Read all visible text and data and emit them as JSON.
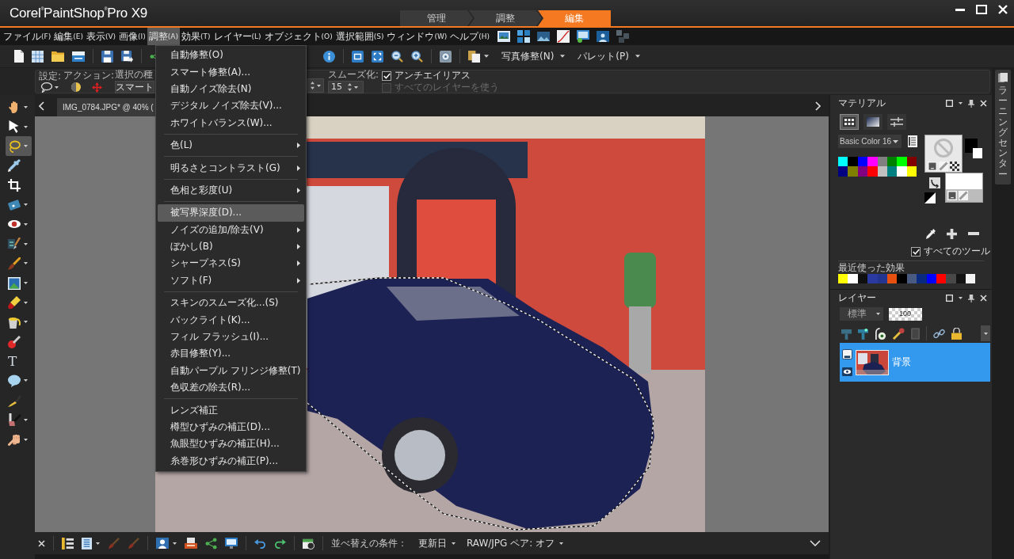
{
  "title_bar": {
    "app_title": "Corel$^{®}$PaintShop$^{®}$Pro X9",
    "workspace_tabs": [
      {
        "label": "管理",
        "selected": false
      },
      {
        "label": "調整",
        "selected": false
      },
      {
        "label": "編集",
        "selected": true
      }
    ]
  },
  "menu_bar": {
    "items": [
      {
        "label": "ファイル",
        "key": "(F)",
        "selected": false
      },
      {
        "label": "編集",
        "key": "(E)",
        "selected": false
      },
      {
        "label": "表示",
        "key": "(V)",
        "selected": false
      },
      {
        "label": "画像",
        "key": "(I)",
        "selected": false
      },
      {
        "label": "調整",
        "key": "(A)",
        "selected": true
      },
      {
        "label": "効果",
        "key": "(T)",
        "selected": false
      },
      {
        "label": "レイヤー",
        "key": "(L)",
        "selected": false
      },
      {
        "label": "オブジェクト",
        "key": "(O)",
        "selected": false
      },
      {
        "label": "選択範囲",
        "key": "(S)",
        "selected": false
      },
      {
        "label": "ウィンドウ",
        "key": "(W)",
        "selected": false
      },
      {
        "label": "ヘルプ",
        "key": "(H)",
        "selected": false
      }
    ]
  },
  "toolbar": {
    "photo_fix": "写真修整(N)",
    "palettes": "パレット(P)"
  },
  "tool_options": {
    "presets_label": "設定:",
    "actions_label": "アクション:",
    "selection_type_label": "選択の種",
    "selection_type_value": "スマート",
    "smoothing_label": "スムーズ化:",
    "smoothing_value": "15",
    "antialias": {
      "label": "アンチエイリアス",
      "checked": true,
      "disabled": false
    },
    "all_layers": {
      "label": "すべてのレイヤーを使う",
      "checked": false,
      "disabled": true
    }
  },
  "toolbox": [
    {
      "selected": false,
      "dropdown": true
    },
    {
      "selected": false,
      "dropdown": true
    },
    {
      "selected": true,
      "dropdown": true
    },
    {
      "selected": false,
      "dropdown": false
    },
    {
      "selected": false,
      "dropdown": false
    },
    {
      "selected": false,
      "dropdown": true
    },
    {
      "selected": false,
      "dropdown": true
    },
    {
      "selected": false,
      "dropdown": true
    },
    {
      "selected": false,
      "dropdown": true
    },
    {
      "selected": false,
      "dropdown": true
    },
    {
      "selected": false,
      "dropdown": true
    },
    {
      "selected": false,
      "dropdown": true
    },
    {
      "selected": false,
      "dropdown": false
    },
    {
      "selected": false,
      "dropdown": false,
      "glyph": "T"
    },
    {
      "selected": false,
      "dropdown": true
    },
    {
      "selected": false,
      "dropdown": false
    },
    {
      "selected": false,
      "dropdown": true
    },
    {
      "selected": false,
      "dropdown": true
    }
  ],
  "document_tab": {
    "label": "IMG_0784.JPG* @ 40% ("
  },
  "adjust_menu": {
    "items": [
      {
        "kind": "item",
        "label": "自動修整(O)",
        "selected": false,
        "submenu": false
      },
      {
        "kind": "item",
        "label": "スマート修整(A)...",
        "selected": false,
        "submenu": false
      },
      {
        "kind": "item",
        "label": "自動ノイズ除去(N)",
        "selected": false,
        "submenu": false
      },
      {
        "kind": "item",
        "label": "デジタル ノイズ除去(V)...",
        "selected": false,
        "submenu": false
      },
      {
        "kind": "item",
        "label": "ホワイトバランス(W)...",
        "selected": false,
        "submenu": false
      },
      {
        "kind": "separator"
      },
      {
        "kind": "item",
        "label": "色(L)",
        "selected": false,
        "submenu": true
      },
      {
        "kind": "separator"
      },
      {
        "kind": "item",
        "label": "明るさとコントラスト(G)",
        "selected": false,
        "submenu": true
      },
      {
        "kind": "separator"
      },
      {
        "kind": "item",
        "label": "色相と彩度(U)",
        "selected": false,
        "submenu": true
      },
      {
        "kind": "separator"
      },
      {
        "kind": "item",
        "label": "被写界深度(D)...",
        "selected": true,
        "submenu": false
      },
      {
        "kind": "item",
        "label": "ノイズの追加/除去(V)",
        "selected": false,
        "submenu": true
      },
      {
        "kind": "item",
        "label": "ぼかし(B)",
        "selected": false,
        "submenu": true
      },
      {
        "kind": "item",
        "label": "シャープネス(S)",
        "selected": false,
        "submenu": true
      },
      {
        "kind": "item",
        "label": "ソフト(F)",
        "selected": false,
        "submenu": true
      },
      {
        "kind": "separator"
      },
      {
        "kind": "item",
        "label": "スキンのスムーズ化...(S)",
        "selected": false,
        "submenu": false
      },
      {
        "kind": "item",
        "label": "バックライト(K)...",
        "selected": false,
        "submenu": false
      },
      {
        "kind": "item",
        "label": "フィル フラッシュ(I)...",
        "selected": false,
        "submenu": false
      },
      {
        "kind": "item",
        "label": "赤目修整(Y)...",
        "selected": false,
        "submenu": false
      },
      {
        "kind": "item",
        "label": "自動パープル フリンジ修整(T)",
        "selected": false,
        "submenu": false
      },
      {
        "kind": "item",
        "label": "色収差の除去(R)...",
        "selected": false,
        "submenu": false
      },
      {
        "kind": "separator"
      },
      {
        "kind": "item",
        "label": "レンズ補正",
        "selected": false,
        "submenu": false
      },
      {
        "kind": "item",
        "label": "樽型ひずみの補正(D)...",
        "selected": false,
        "submenu": false
      },
      {
        "kind": "item",
        "label": "魚眼型ひずみの補正(H)...",
        "selected": false,
        "submenu": false
      },
      {
        "kind": "item",
        "label": "糸巻形ひずみの補正(P)...",
        "selected": false,
        "submenu": false
      }
    ]
  },
  "materials_panel": {
    "title": "マテリアル",
    "view_tabs": [
      {
        "selected": true
      },
      {
        "selected": false
      },
      {
        "selected": false
      }
    ],
    "palette": "Basic Color 16",
    "swatches": [
      {
        "color": "#00ffff"
      },
      {
        "color": "#000000"
      },
      {
        "color": "#0000ff"
      },
      {
        "color": "#ff00ff"
      },
      {
        "color": "#808080"
      },
      {
        "color": "#008000"
      },
      {
        "color": "#00ff00"
      },
      {
        "color": "#800000"
      },
      {
        "color": "#000080"
      },
      {
        "color": "#808000"
      },
      {
        "color": "#800080"
      },
      {
        "color": "#ff0000"
      },
      {
        "color": "#c0c0c0"
      },
      {
        "color": "#008080"
      },
      {
        "color": "#ffffff"
      },
      {
        "color": "#ffff00"
      }
    ],
    "all_tools": {
      "label": "すべてのツール",
      "checked": true
    },
    "recent_label": "最近使った効果",
    "recent_effects": [
      {
        "color": "#ffff00"
      },
      {
        "color": "#ffffff"
      },
      {
        "color": "#101010"
      },
      {
        "color": "#2a3aa0"
      },
      {
        "color": "#24358f"
      },
      {
        "color": "#e85010"
      },
      {
        "color": "#000000"
      },
      {
        "color": "#4a5a80"
      },
      {
        "color": "#0a2a80"
      },
      {
        "color": "#0000ff"
      },
      {
        "color": "#ff0000"
      },
      {
        "color": "#484848"
      },
      {
        "color": "#141414"
      },
      {
        "color": "#f4f4f4"
      }
    ]
  },
  "layers_panel": {
    "title": "レイヤー",
    "blend_mode": "標準",
    "opacity": "100",
    "layers": [
      {
        "name": "背景",
        "selected": true
      }
    ]
  },
  "learning_center": {
    "label": "ラーニングセンター"
  },
  "organizer_bar": {
    "sort_label": "並べ替えの条件：",
    "sort_value": "更新日",
    "raw_jpg_pair": "RAW/JPG ペア: オフ"
  }
}
